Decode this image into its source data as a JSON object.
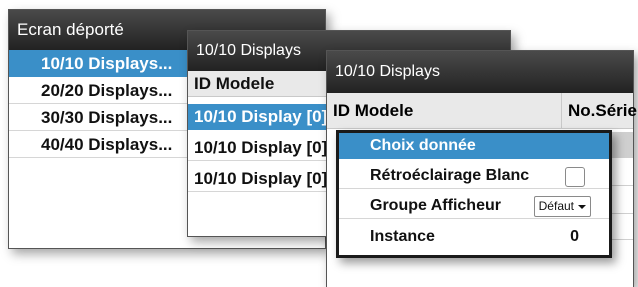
{
  "panel1": {
    "title": "Ecran déporté",
    "items": [
      "10/10 Displays...",
      "20/20 Displays...",
      "30/30 Displays...",
      "40/40 Displays..."
    ]
  },
  "panel2": {
    "title": "10/10 Displays",
    "header": "ID Modele",
    "rows": [
      "10/10 Display [0]",
      "10/10 Display [0]",
      "10/10 Display [0]"
    ]
  },
  "panel3": {
    "title": "10/10 Displays",
    "col_id": "ID Modele",
    "col_serial": "No.Série."
  },
  "menu": {
    "choice": "Choix donnée",
    "backlight_label": "Rétroéclairage Blanc",
    "group_label": "Groupe Afficheur",
    "group_value": "Défaut",
    "instance_label": "Instance",
    "instance_value": "0"
  },
  "colors": {
    "accent": "#3a8fc8",
    "titlebar": "#333333"
  }
}
